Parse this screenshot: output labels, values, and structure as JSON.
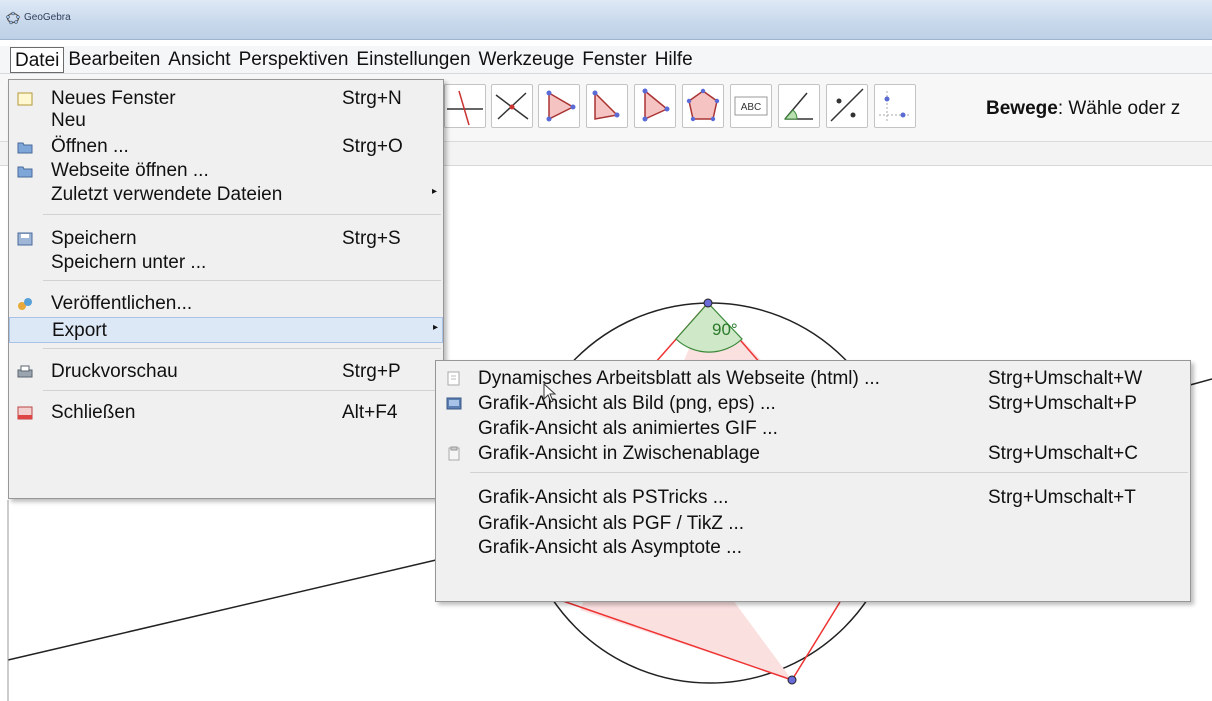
{
  "window": {
    "title": "GeoGebra"
  },
  "menubar": {
    "items": [
      "Datei",
      "Bearbeiten",
      "Ansicht",
      "Perspektiven",
      "Einstellungen",
      "Werkzeuge",
      "Fenster",
      "Hilfe"
    ]
  },
  "toolbar": {
    "hint_bold": "Bewege",
    "hint_rest": ": Wähle oder z",
    "tools": [
      "perpendicular-line-icon",
      "intersect-icon",
      "polygon-icon",
      "vector-icon",
      "angle-polygon-icon",
      "regular-polygon-icon",
      "text-abc-icon",
      "angle-icon",
      "reflect-icon",
      "move-graphics-icon"
    ]
  },
  "graphics": {
    "angle_label": "90°"
  },
  "datei_menu": {
    "items": [
      {
        "label": "Neues Fenster",
        "shortcut": "Strg+N",
        "icon": "new-window-icon"
      },
      {
        "label": "Neu",
        "shortcut": ""
      },
      {
        "label": "Öffnen ...",
        "shortcut": "Strg+O",
        "icon": "folder-icon"
      },
      {
        "label": "Webseite öffnen ...",
        "shortcut": "",
        "icon": "folder-icon"
      },
      {
        "label": "Zuletzt verwendete Dateien",
        "shortcut": ""
      },
      {
        "label": "Speichern",
        "shortcut": "Strg+S",
        "icon": "save-icon"
      },
      {
        "label": "Speichern unter ...",
        "shortcut": ""
      },
      {
        "label": "Veröffentlichen...",
        "shortcut": "",
        "icon": "share-icon"
      },
      {
        "label": "Export",
        "shortcut": ""
      },
      {
        "label": "Druckvorschau",
        "shortcut": "Strg+P",
        "icon": "print-icon"
      },
      {
        "label": "Schließen",
        "shortcut": "Alt+F4",
        "icon": "close-window-icon"
      }
    ]
  },
  "export_menu": {
    "items": [
      {
        "label": "Dynamisches Arbeitsblatt als Webseite (html) ...",
        "shortcut": "Strg+Umschalt+W",
        "icon": "html-export-icon"
      },
      {
        "label": "Grafik-Ansicht als Bild (png, eps) ...",
        "shortcut": "Strg+Umschalt+P",
        "icon": "image-export-icon"
      },
      {
        "label": "Grafik-Ansicht als animiertes GIF ...",
        "shortcut": ""
      },
      {
        "label": "Grafik-Ansicht in Zwischenablage",
        "shortcut": "Strg+Umschalt+C",
        "icon": "clipboard-icon"
      },
      {
        "label": "Grafik-Ansicht als PSTricks ...",
        "shortcut": "Strg+Umschalt+T"
      },
      {
        "label": "Grafik-Ansicht als PGF / TikZ ...",
        "shortcut": ""
      },
      {
        "label": "Grafik-Ansicht als Asymptote ...",
        "shortcut": ""
      }
    ]
  }
}
